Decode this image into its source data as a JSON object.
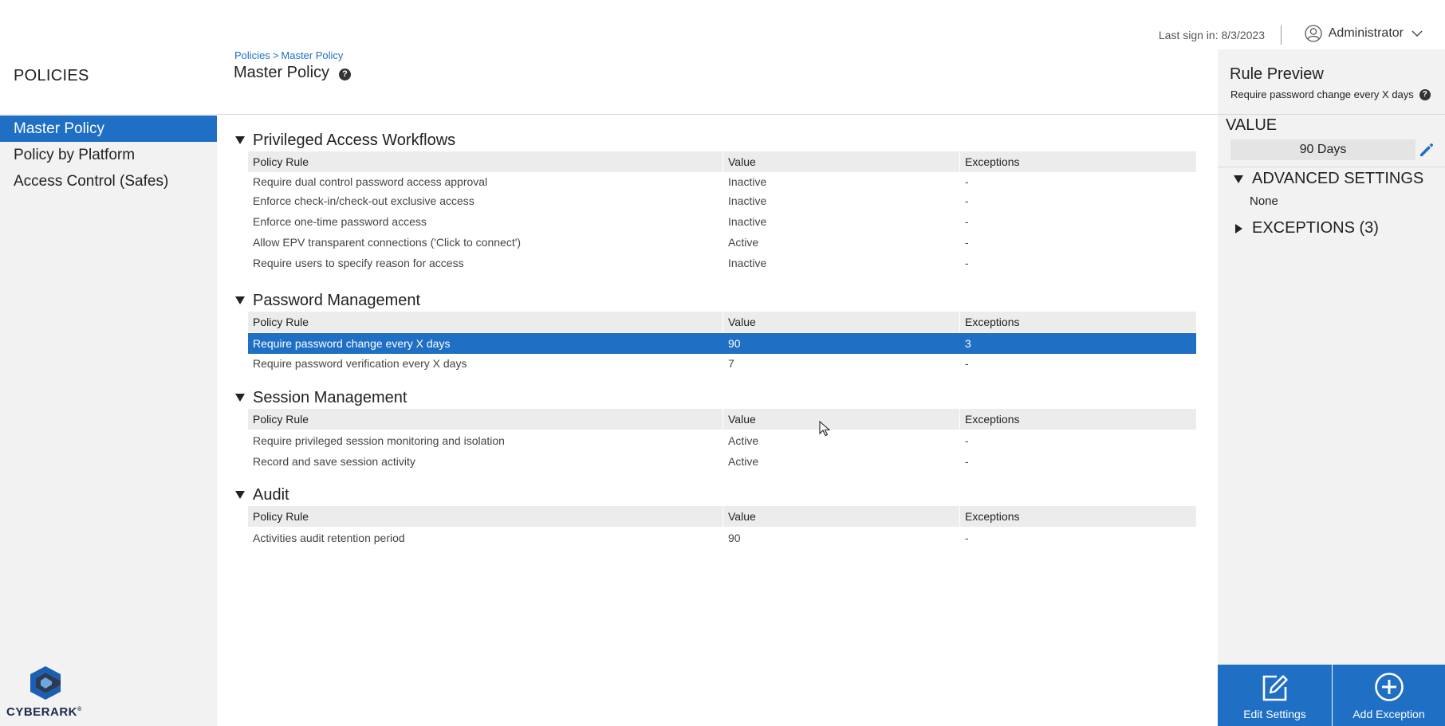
{
  "sidebar": {
    "title": "POLICIES",
    "items": [
      {
        "label": "Master Policy"
      },
      {
        "label": "Policy by Platform"
      },
      {
        "label": "Access Control (Safes)"
      }
    ],
    "logo_text": "CYBERARK",
    "logo_mark": "®"
  },
  "header": {
    "last_sign_in": "Last sign in: 8/3/2023",
    "user_name": "Administrator"
  },
  "breadcrumb": {
    "root": "Policies",
    "separator": ">",
    "current": "Master Policy"
  },
  "page_title": "Master Policy",
  "help_glyph": "?",
  "columns": {
    "rule": "Policy Rule",
    "value": "Value",
    "exceptions": "Exceptions"
  },
  "sections": [
    {
      "title": "Privileged Access Workflows",
      "rows": [
        {
          "rule": "Require dual control password access approval",
          "value": "Inactive",
          "exceptions": "-"
        },
        {
          "rule": "Enforce check-in/check-out exclusive access",
          "value": "Inactive",
          "exceptions": "-"
        },
        {
          "rule": "Enforce one-time password access",
          "value": "Inactive",
          "exceptions": "-"
        },
        {
          "rule": "Allow EPV transparent connections ('Click to connect')",
          "value": "Active",
          "exceptions": "-"
        },
        {
          "rule": "Require users to specify reason for access",
          "value": "Inactive",
          "exceptions": "-"
        }
      ]
    },
    {
      "title": "Password Management",
      "rows": [
        {
          "rule": "Require password change every X days",
          "value": "90",
          "exceptions": "3",
          "selected": true
        },
        {
          "rule": "Require password verification every X days",
          "value": "7",
          "exceptions": "-"
        }
      ]
    },
    {
      "title": "Session Management",
      "rows": [
        {
          "rule": "Require privileged session monitoring and isolation",
          "value": "Active",
          "exceptions": "-"
        },
        {
          "rule": "Record and save session activity",
          "value": "Active",
          "exceptions": "-"
        }
      ]
    },
    {
      "title": "Audit",
      "rows": [
        {
          "rule": "Activities audit retention period",
          "value": "90",
          "exceptions": "-"
        }
      ]
    }
  ],
  "rule_preview": {
    "title": "Rule Preview",
    "subtitle": "Require password change every X days",
    "value_label": "VALUE",
    "value": "90 Days",
    "advanced_label": "ADVANCED SETTINGS",
    "advanced_value": "None",
    "exceptions_label": "EXCEPTIONS (3)"
  },
  "actions": {
    "edit": "Edit Settings",
    "add": "Add Exception"
  },
  "colors": {
    "accent": "#1f6fc5",
    "panel_bg": "#f2f2f2",
    "header_row_bg": "#ececec"
  }
}
